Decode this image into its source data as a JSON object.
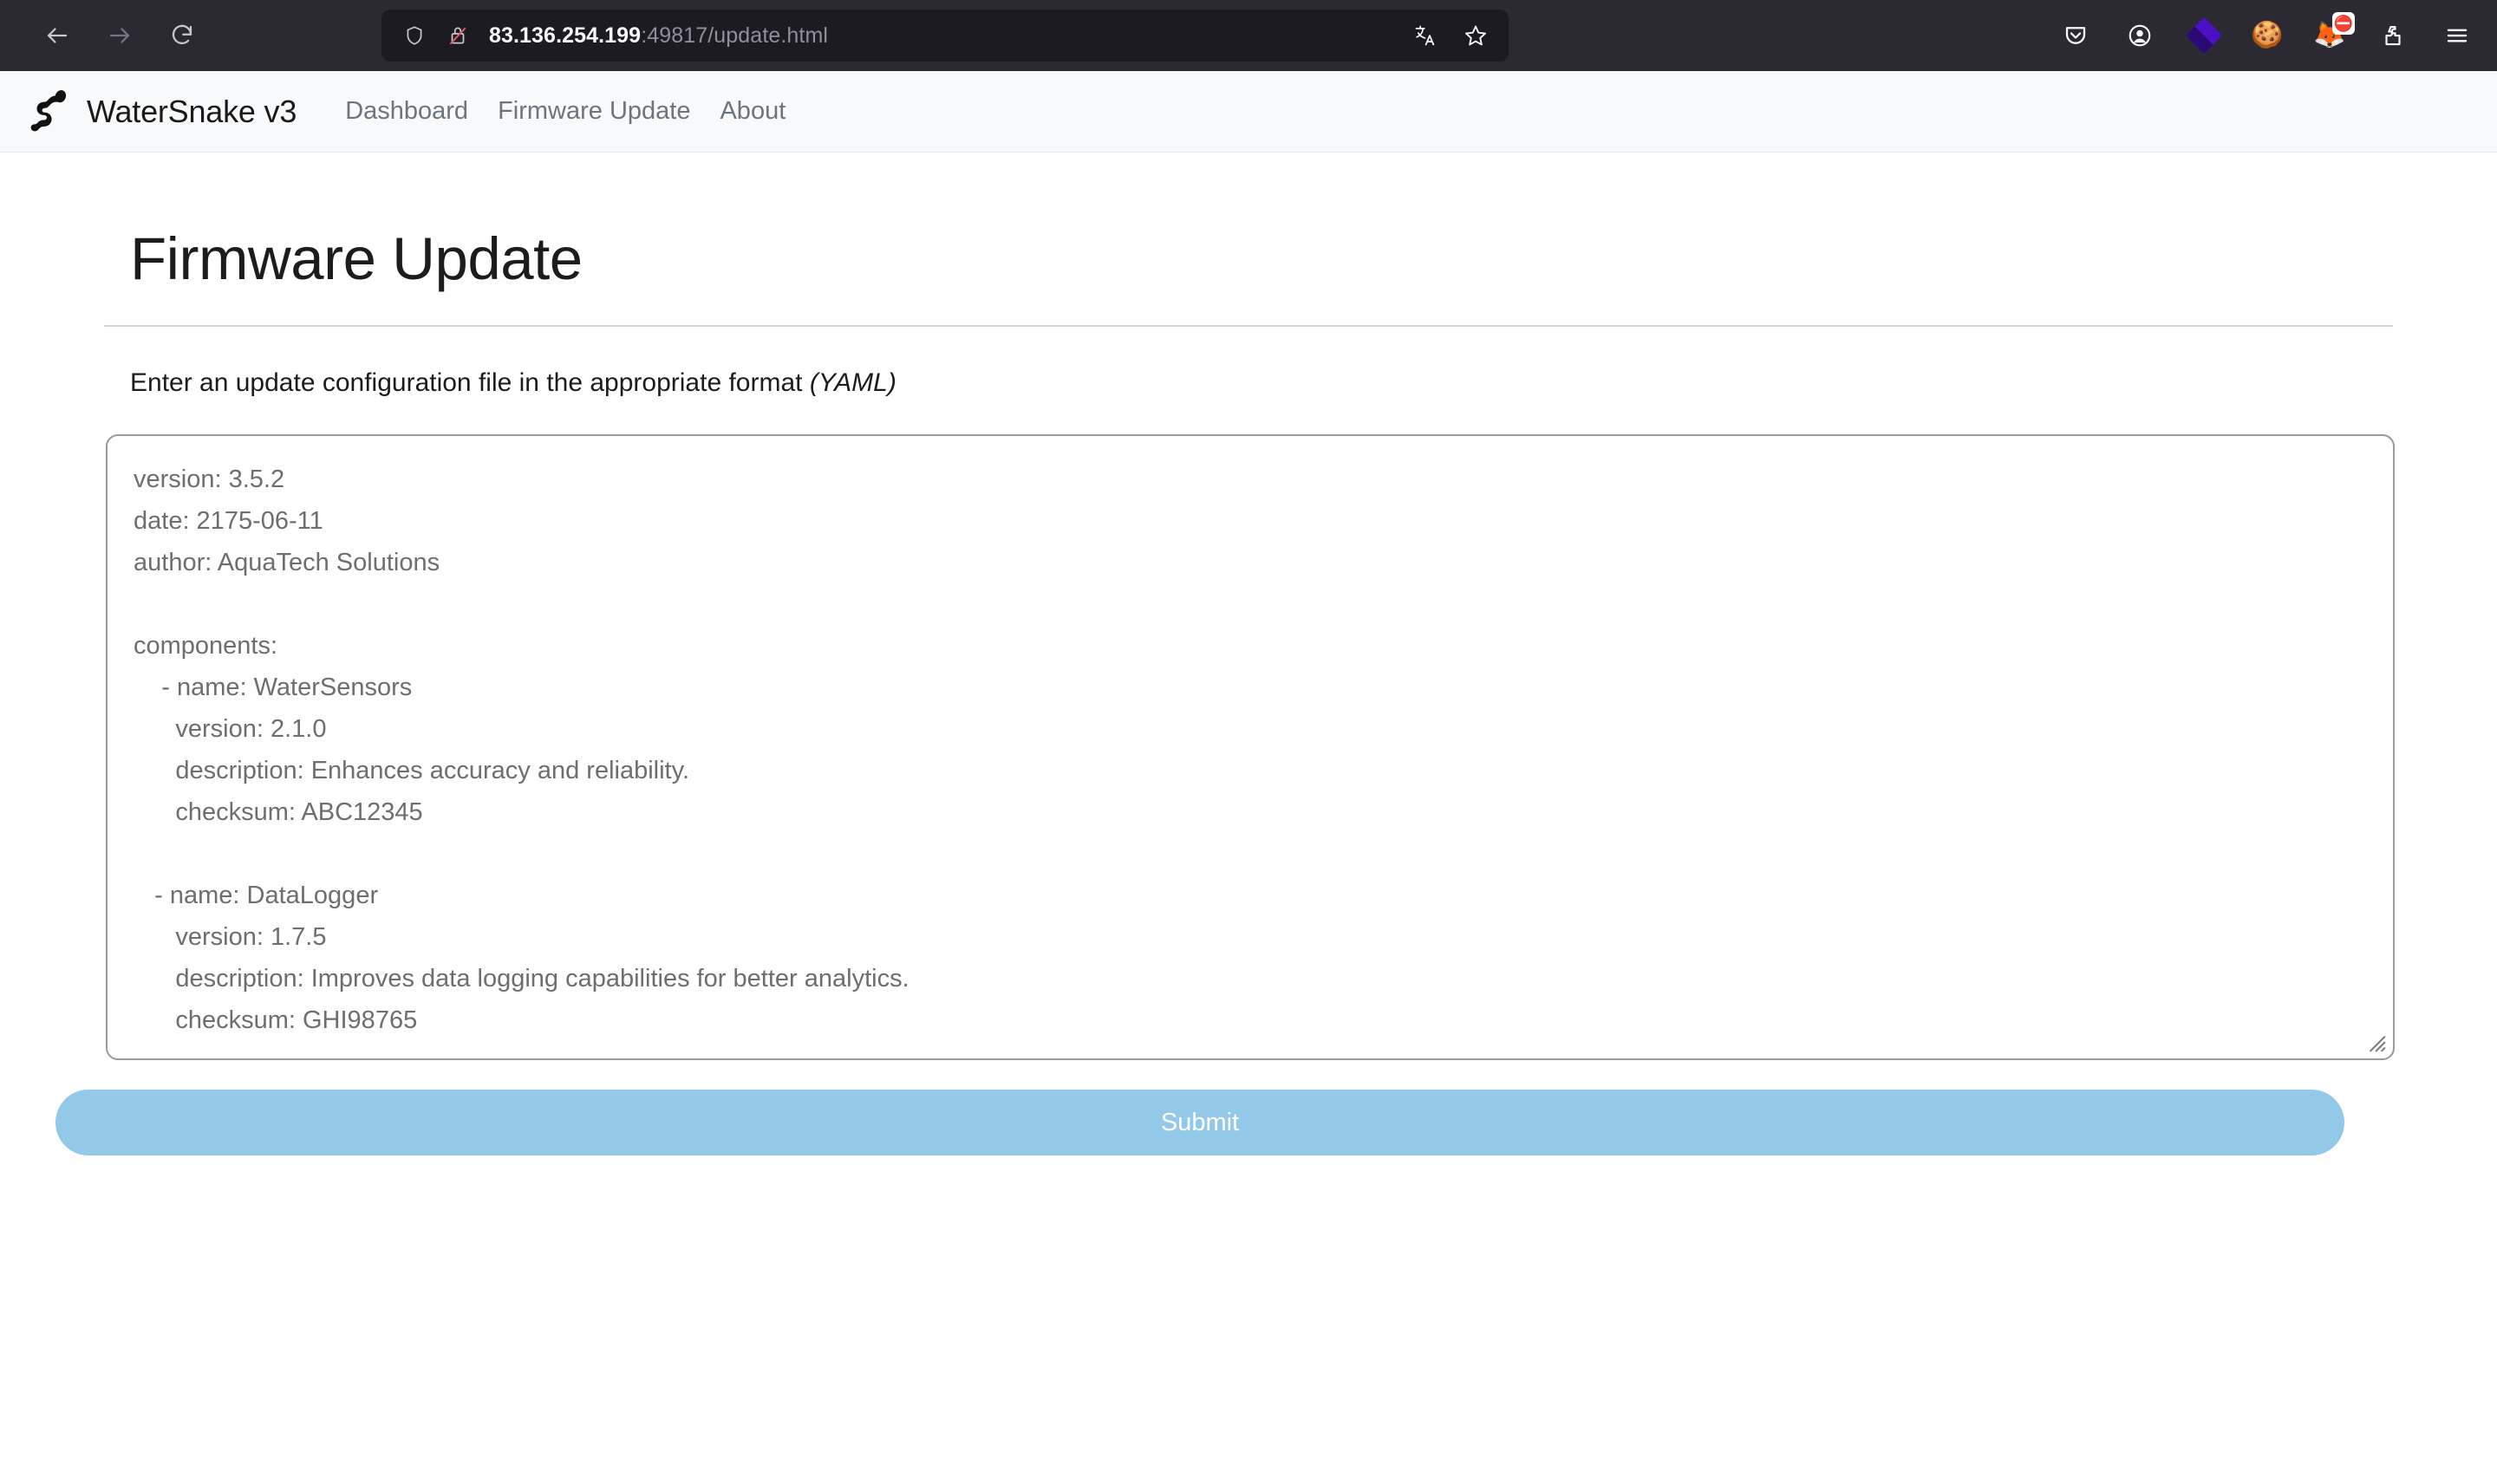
{
  "browser": {
    "url_host": "83.136.254.199",
    "url_rest": ":49817/update.html",
    "icons": {
      "back": "back-arrow-icon",
      "forward": "forward-arrow-icon",
      "reload": "reload-icon",
      "shield": "shield-icon",
      "insecure_lock": "lock-crossed-icon",
      "translate": "translate-icon",
      "bookmark": "star-icon",
      "pocket": "pocket-icon",
      "account": "account-circle-icon",
      "diamond": "diamond-extension-icon",
      "cookie": "cookie-icon",
      "fox_blocked": "fox-blocked-extension-icon",
      "extensions": "puzzle-piece-icon",
      "menu": "hamburger-menu-icon"
    },
    "fox_badge_glyph": "⛔",
    "cookie_glyph": "🍪",
    "fox_glyph": "🦊"
  },
  "site_nav": {
    "brand_title": "WaterSnake v3",
    "brand_logo_icon": "snake-icon",
    "links": [
      {
        "label": "Dashboard"
      },
      {
        "label": "Firmware Update"
      },
      {
        "label": "About"
      }
    ]
  },
  "main": {
    "page_title": "Firmware Update",
    "subtitle_text": "Enter an update configuration file in the appropriate format ",
    "subtitle_emphasis": "(YAML)",
    "submit_label": "Submit",
    "textarea_placeholder": "",
    "config_yaml": "version: 3.5.2\ndate: 2175-06-11\nauthor: AquaTech Solutions\n\ncomponents:\n    - name: WaterSensors\n      version: 2.1.0\n      description: Enhances accuracy and reliability.\n      checksum: ABC12345\n\n   - name: DataLogger\n      version: 1.7.5\n      description: Improves data logging capabilities for better analytics.\n      checksum: GHI98765",
    "config": {
      "version": "3.5.2",
      "date": "2175-06-11",
      "author": "AquaTech Solutions",
      "components": [
        {
          "name": "WaterSensors",
          "version": "2.1.0",
          "description": "Enhances accuracy and reliability.",
          "checksum": "ABC12345"
        },
        {
          "name": "DataLogger",
          "version": "1.7.5",
          "description": "Improves data logging capabilities for better analytics.",
          "checksum": "GHI98765"
        }
      ]
    }
  },
  "colors": {
    "chrome_bg": "#2b2a33",
    "urlbar_bg": "#1c1b22",
    "nav_bg": "#f8f9fa",
    "submit_bg": "#92c9e8",
    "textarea_border": "#9a9a9a",
    "muted_text": "#6c757d"
  }
}
